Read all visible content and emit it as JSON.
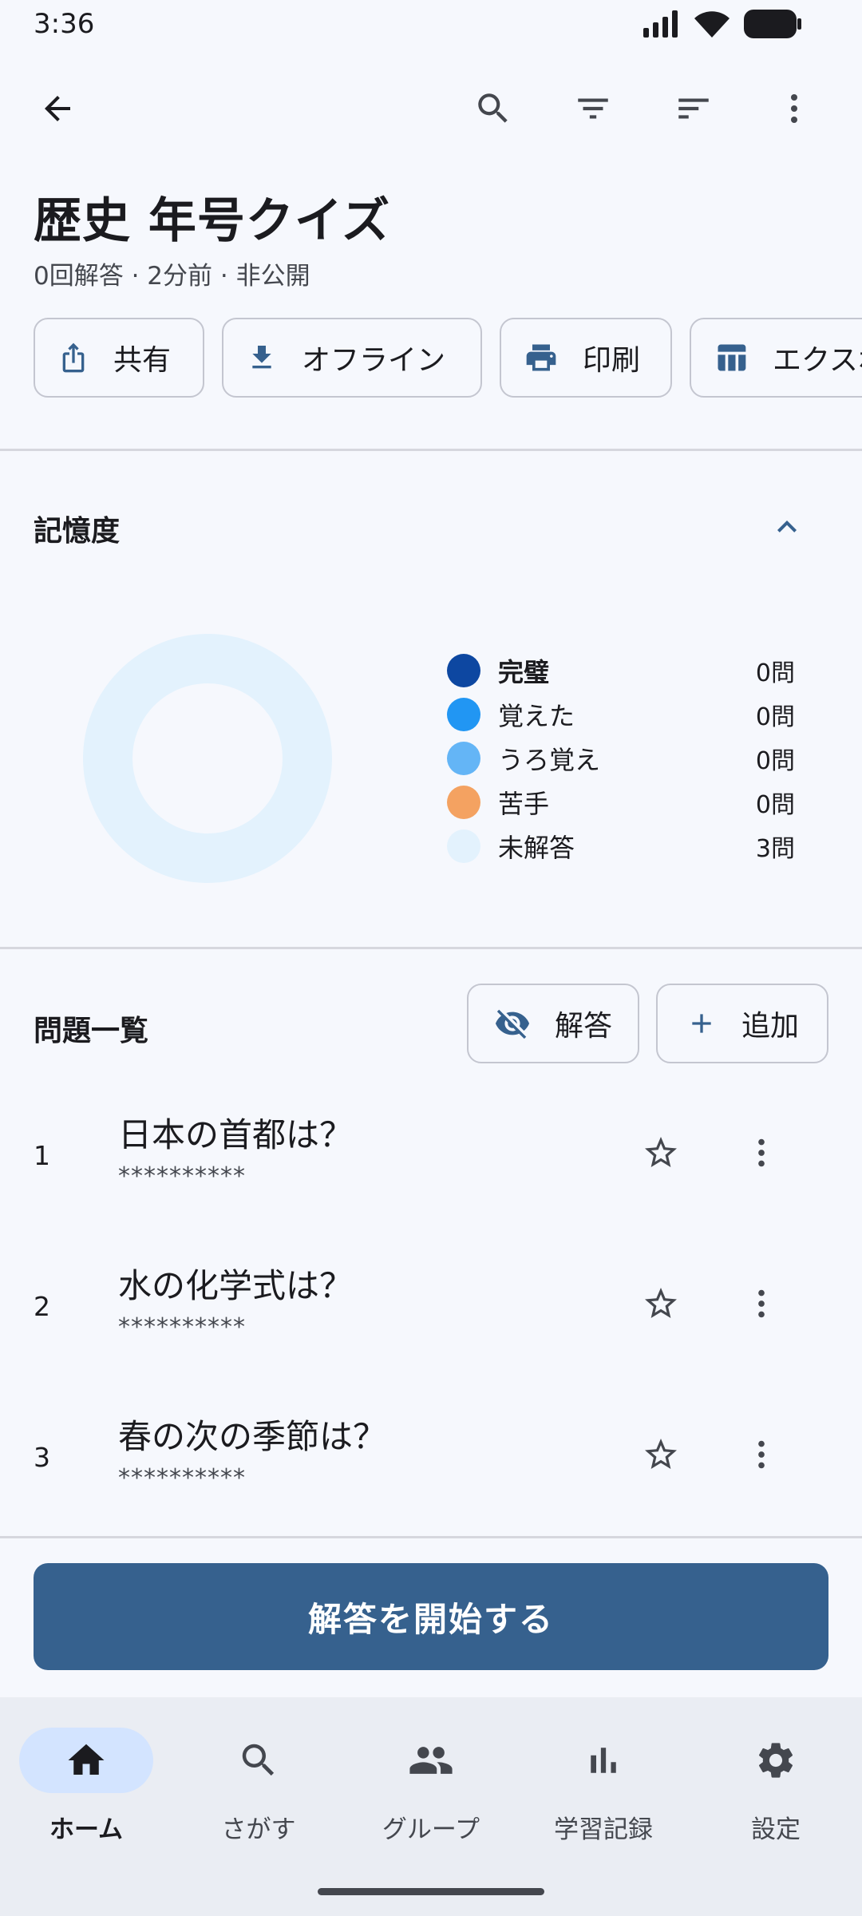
{
  "status_bar": {
    "time": "3:36"
  },
  "page": {
    "title": "歴史 年号クイズ",
    "subtitle": "0回解答 · 2分前 · 非公開"
  },
  "chips": [
    {
      "label": "共有",
      "icon": "share-icon"
    },
    {
      "label": "オフライン",
      "icon": "download-icon"
    },
    {
      "label": "印刷",
      "icon": "print-icon"
    },
    {
      "label": "エクスポート",
      "icon": "table-icon"
    }
  ],
  "memory": {
    "title": "記憶度",
    "legend": [
      {
        "label": "完璧",
        "count": "0問",
        "color": "#0d47a1"
      },
      {
        "label": "覚えた",
        "count": "0問",
        "color": "#2196f3"
      },
      {
        "label": "うろ覚え",
        "count": "0問",
        "color": "#64b5f6"
      },
      {
        "label": "苦手",
        "count": "0問",
        "color": "#f4a261"
      },
      {
        "label": "未解答",
        "count": "3問",
        "color": "#e3f2fd"
      }
    ]
  },
  "questions": {
    "title": "問題一覧",
    "toggle_answer_label": "解答",
    "add_label": "追加",
    "items": [
      {
        "number": "1",
        "text": "日本の首都は？",
        "answer": "**********"
      },
      {
        "number": "2",
        "text": "水の化学式は？",
        "answer": "**********"
      },
      {
        "number": "3",
        "text": "春の次の季節は？",
        "answer": "**********"
      }
    ]
  },
  "start_button": "解答を開始する",
  "nav": {
    "items": [
      {
        "label": "ホーム",
        "icon": "home-icon",
        "active": true
      },
      {
        "label": "さがす",
        "icon": "search-icon",
        "active": false
      },
      {
        "label": "グループ",
        "icon": "group-icon",
        "active": false
      },
      {
        "label": "学習記録",
        "icon": "bar-chart-icon",
        "active": false
      },
      {
        "label": "設定",
        "icon": "gear-icon",
        "active": false
      }
    ]
  },
  "colors": {
    "primary": "#36618e",
    "background": "#f6f8fd",
    "nav_background": "#eaedf3",
    "active_pill": "#d3e4ff"
  }
}
